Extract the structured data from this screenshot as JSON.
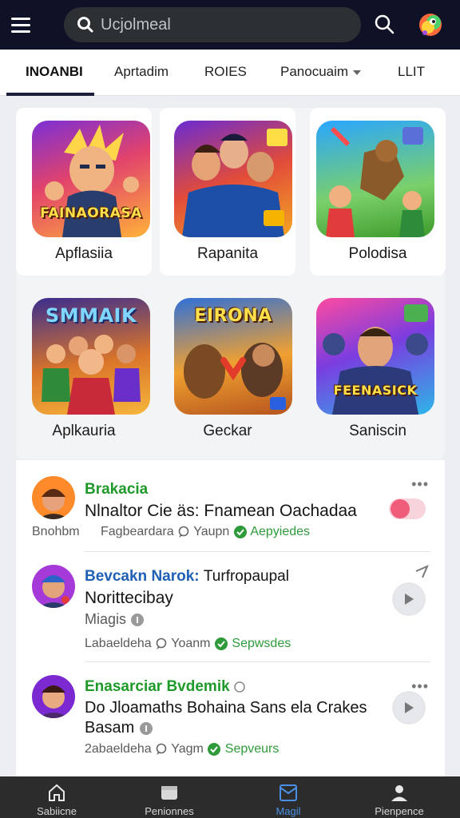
{
  "header": {
    "search_placeholder": "Ucjolmeal"
  },
  "tabs": [
    {
      "label": "INOANBI"
    },
    {
      "label": "Aprtadim"
    },
    {
      "label": "ROIES"
    },
    {
      "label": "Panocuaim"
    },
    {
      "label": "LLIT"
    }
  ],
  "apps": [
    {
      "label": "Apflasiia",
      "tile_text": "FAINAORASA"
    },
    {
      "label": "Rapanita",
      "tile_text": ""
    },
    {
      "label": "Polodisa",
      "tile_text": ""
    },
    {
      "label": "Aplkauria",
      "tile_text": "SMMAIK"
    },
    {
      "label": "Geckar",
      "tile_text": "EIRONA"
    },
    {
      "label": "Saniscin",
      "tile_text": "FEENASICK"
    }
  ],
  "feed": [
    {
      "title": "Brakacia",
      "text": "Nlnaltor Cie äs: Fnamean Oachadaa",
      "meta_left": "Bnohbm",
      "meta_mid": "Fagbeardara",
      "meta_time": "Yaupn",
      "status": "Aepyiedes"
    },
    {
      "title": "Bevcakn Narok:",
      "title_rest": "Turfropaupal",
      "text": "Norittecibay",
      "sub": "Miagis",
      "meta_mid": "Labaeldeha",
      "meta_time": "Yoanm",
      "status": "Sepwsdes"
    },
    {
      "title": "Enasarciar Bvdemik",
      "text": "Do Jloamaths Bohaina Sans ela Crakes",
      "sub": "Basam",
      "meta_mid": "2abaeldeha",
      "meta_time": "Yagm",
      "status": "Sepveurs"
    }
  ],
  "bottom_nav": [
    {
      "label": "Sabiicne"
    },
    {
      "label": "Penionnes"
    },
    {
      "label": "Magil"
    },
    {
      "label": "Pienpence"
    }
  ],
  "colors": {
    "topbar": "#0f1126",
    "accent_green": "#1f9a2a",
    "accent_blue": "#1f5fb5",
    "nav_active": "#4a90e2"
  }
}
